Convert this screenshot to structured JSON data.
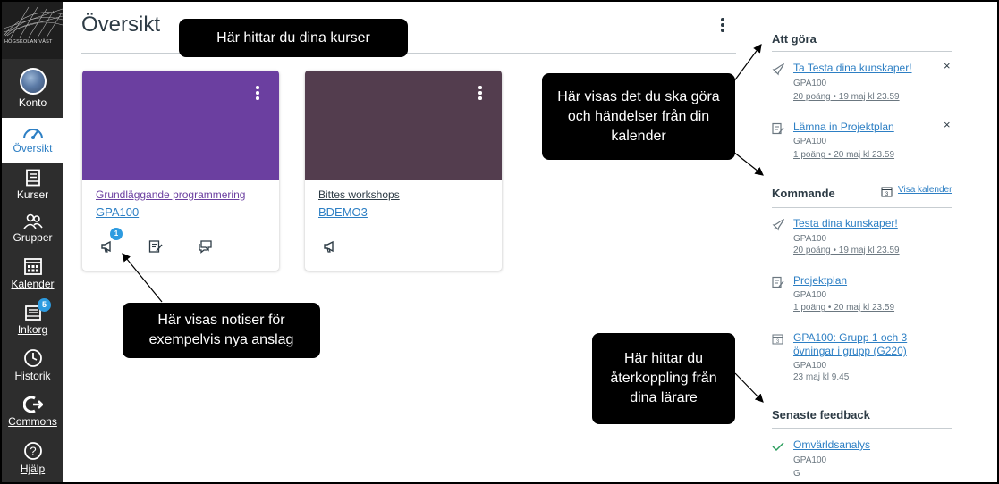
{
  "nav": {
    "logo_text": "HÖGSKOLAN VÄST",
    "items": [
      {
        "label": "Konto"
      },
      {
        "label": "Översikt"
      },
      {
        "label": "Kurser"
      },
      {
        "label": "Grupper"
      },
      {
        "label": "Kalender"
      },
      {
        "label": "Inkorg",
        "badge": "5"
      },
      {
        "label": "Historik"
      },
      {
        "label": "Commons"
      },
      {
        "label": "Hjälp"
      }
    ]
  },
  "header": {
    "title": "Översikt"
  },
  "callouts": {
    "courses": "Här hittar du dina kurser",
    "todo": "Här visas det du ska göra och händelser från din kalender",
    "notices": "Här visas notiser för exempelvis nya anslag",
    "feedback": "Här hittar du återkoppling från dina lärare"
  },
  "cards": [
    {
      "name": "Grundläggande programmering",
      "code": "GPA100",
      "color": "#6b3fa0",
      "notice_badge": "1"
    },
    {
      "name": "Bittes workshops",
      "code": "BDEMO3",
      "color": "#533d4e"
    }
  ],
  "sidebar": {
    "todo_title": "Att göra",
    "todo_items": [
      {
        "title": "Ta Testa dina kunskaper!",
        "course": "GPA100",
        "meta": "20 poäng • 19 maj kl 23.59"
      },
      {
        "title": "Lämna in Projektplan",
        "course": "GPA100",
        "meta": "1 poäng • 20 maj kl 23.59"
      }
    ],
    "upcoming_title": "Kommande",
    "view_calendar": "Visa kalender",
    "upcoming_items": [
      {
        "title": "Testa dina kunskaper!",
        "course": "GPA100",
        "meta": "20 poäng • 19 maj kl 23.59"
      },
      {
        "title": "Projektplan",
        "course": "GPA100",
        "meta": "1 poäng • 20 maj kl 23.59"
      },
      {
        "title": "GPA100: Grupp 1 och 3",
        "title2": "övningar i grupp (G220)",
        "course": "GPA100",
        "meta": "23 maj kl 9.45"
      }
    ],
    "feedback_title": "Senaste feedback",
    "feedback_items": [
      {
        "title": "Omvärldsanalys",
        "course": "GPA100",
        "grade": "G"
      }
    ]
  },
  "colors": {
    "link": "#2d7fc4",
    "nav_bg": "#2d2d2d",
    "badge": "#2d9be0"
  }
}
